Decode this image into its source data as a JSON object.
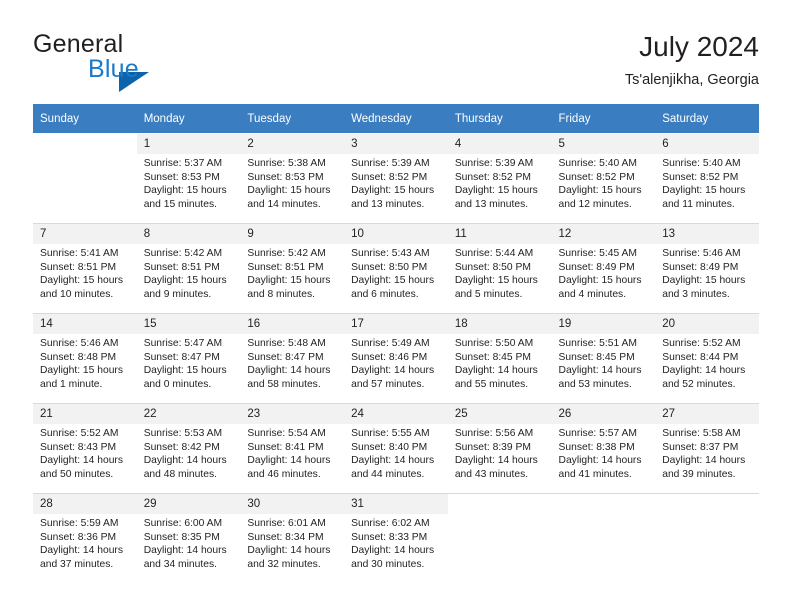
{
  "brand": {
    "name_top": "General",
    "name_bottom": "Blue",
    "mark": "triangle-logo",
    "blue": "#1a79c8"
  },
  "header": {
    "title": "July 2024",
    "subtitle": "Ts'alenjikha, Georgia"
  },
  "theme": {
    "header_row_bg": "#3b7dc1",
    "header_row_text": "#ffffff",
    "shaded_cell_bg": "#f2f2f2",
    "text": "#231f20"
  },
  "weekday_headers": [
    "Sunday",
    "Monday",
    "Tuesday",
    "Wednesday",
    "Thursday",
    "Friday",
    "Saturday"
  ],
  "weeks": [
    [
      {
        "day": "",
        "sunrise": "",
        "sunset": "",
        "daylight": "",
        "empty": true
      },
      {
        "day": "1",
        "sunrise": "Sunrise: 5:37 AM",
        "sunset": "Sunset: 8:53 PM",
        "daylight_1": "Daylight: 15 hours",
        "daylight_2": "and 15 minutes."
      },
      {
        "day": "2",
        "sunrise": "Sunrise: 5:38 AM",
        "sunset": "Sunset: 8:53 PM",
        "daylight_1": "Daylight: 15 hours",
        "daylight_2": "and 14 minutes."
      },
      {
        "day": "3",
        "sunrise": "Sunrise: 5:39 AM",
        "sunset": "Sunset: 8:52 PM",
        "daylight_1": "Daylight: 15 hours",
        "daylight_2": "and 13 minutes."
      },
      {
        "day": "4",
        "sunrise": "Sunrise: 5:39 AM",
        "sunset": "Sunset: 8:52 PM",
        "daylight_1": "Daylight: 15 hours",
        "daylight_2": "and 13 minutes."
      },
      {
        "day": "5",
        "sunrise": "Sunrise: 5:40 AM",
        "sunset": "Sunset: 8:52 PM",
        "daylight_1": "Daylight: 15 hours",
        "daylight_2": "and 12 minutes."
      },
      {
        "day": "6",
        "sunrise": "Sunrise: 5:40 AM",
        "sunset": "Sunset: 8:52 PM",
        "daylight_1": "Daylight: 15 hours",
        "daylight_2": "and 11 minutes."
      }
    ],
    [
      {
        "day": "7",
        "sunrise": "Sunrise: 5:41 AM",
        "sunset": "Sunset: 8:51 PM",
        "daylight_1": "Daylight: 15 hours",
        "daylight_2": "and 10 minutes."
      },
      {
        "day": "8",
        "sunrise": "Sunrise: 5:42 AM",
        "sunset": "Sunset: 8:51 PM",
        "daylight_1": "Daylight: 15 hours",
        "daylight_2": "and 9 minutes."
      },
      {
        "day": "9",
        "sunrise": "Sunrise: 5:42 AM",
        "sunset": "Sunset: 8:51 PM",
        "daylight_1": "Daylight: 15 hours",
        "daylight_2": "and 8 minutes."
      },
      {
        "day": "10",
        "sunrise": "Sunrise: 5:43 AM",
        "sunset": "Sunset: 8:50 PM",
        "daylight_1": "Daylight: 15 hours",
        "daylight_2": "and 6 minutes."
      },
      {
        "day": "11",
        "sunrise": "Sunrise: 5:44 AM",
        "sunset": "Sunset: 8:50 PM",
        "daylight_1": "Daylight: 15 hours",
        "daylight_2": "and 5 minutes."
      },
      {
        "day": "12",
        "sunrise": "Sunrise: 5:45 AM",
        "sunset": "Sunset: 8:49 PM",
        "daylight_1": "Daylight: 15 hours",
        "daylight_2": "and 4 minutes."
      },
      {
        "day": "13",
        "sunrise": "Sunrise: 5:46 AM",
        "sunset": "Sunset: 8:49 PM",
        "daylight_1": "Daylight: 15 hours",
        "daylight_2": "and 3 minutes."
      }
    ],
    [
      {
        "day": "14",
        "sunrise": "Sunrise: 5:46 AM",
        "sunset": "Sunset: 8:48 PM",
        "daylight_1": "Daylight: 15 hours",
        "daylight_2": "and 1 minute."
      },
      {
        "day": "15",
        "sunrise": "Sunrise: 5:47 AM",
        "sunset": "Sunset: 8:47 PM",
        "daylight_1": "Daylight: 15 hours",
        "daylight_2": "and 0 minutes."
      },
      {
        "day": "16",
        "sunrise": "Sunrise: 5:48 AM",
        "sunset": "Sunset: 8:47 PM",
        "daylight_1": "Daylight: 14 hours",
        "daylight_2": "and 58 minutes."
      },
      {
        "day": "17",
        "sunrise": "Sunrise: 5:49 AM",
        "sunset": "Sunset: 8:46 PM",
        "daylight_1": "Daylight: 14 hours",
        "daylight_2": "and 57 minutes."
      },
      {
        "day": "18",
        "sunrise": "Sunrise: 5:50 AM",
        "sunset": "Sunset: 8:45 PM",
        "daylight_1": "Daylight: 14 hours",
        "daylight_2": "and 55 minutes."
      },
      {
        "day": "19",
        "sunrise": "Sunrise: 5:51 AM",
        "sunset": "Sunset: 8:45 PM",
        "daylight_1": "Daylight: 14 hours",
        "daylight_2": "and 53 minutes."
      },
      {
        "day": "20",
        "sunrise": "Sunrise: 5:52 AM",
        "sunset": "Sunset: 8:44 PM",
        "daylight_1": "Daylight: 14 hours",
        "daylight_2": "and 52 minutes."
      }
    ],
    [
      {
        "day": "21",
        "sunrise": "Sunrise: 5:52 AM",
        "sunset": "Sunset: 8:43 PM",
        "daylight_1": "Daylight: 14 hours",
        "daylight_2": "and 50 minutes."
      },
      {
        "day": "22",
        "sunrise": "Sunrise: 5:53 AM",
        "sunset": "Sunset: 8:42 PM",
        "daylight_1": "Daylight: 14 hours",
        "daylight_2": "and 48 minutes."
      },
      {
        "day": "23",
        "sunrise": "Sunrise: 5:54 AM",
        "sunset": "Sunset: 8:41 PM",
        "daylight_1": "Daylight: 14 hours",
        "daylight_2": "and 46 minutes."
      },
      {
        "day": "24",
        "sunrise": "Sunrise: 5:55 AM",
        "sunset": "Sunset: 8:40 PM",
        "daylight_1": "Daylight: 14 hours",
        "daylight_2": "and 44 minutes."
      },
      {
        "day": "25",
        "sunrise": "Sunrise: 5:56 AM",
        "sunset": "Sunset: 8:39 PM",
        "daylight_1": "Daylight: 14 hours",
        "daylight_2": "and 43 minutes."
      },
      {
        "day": "26",
        "sunrise": "Sunrise: 5:57 AM",
        "sunset": "Sunset: 8:38 PM",
        "daylight_1": "Daylight: 14 hours",
        "daylight_2": "and 41 minutes."
      },
      {
        "day": "27",
        "sunrise": "Sunrise: 5:58 AM",
        "sunset": "Sunset: 8:37 PM",
        "daylight_1": "Daylight: 14 hours",
        "daylight_2": "and 39 minutes."
      }
    ],
    [
      {
        "day": "28",
        "sunrise": "Sunrise: 5:59 AM",
        "sunset": "Sunset: 8:36 PM",
        "daylight_1": "Daylight: 14 hours",
        "daylight_2": "and 37 minutes."
      },
      {
        "day": "29",
        "sunrise": "Sunrise: 6:00 AM",
        "sunset": "Sunset: 8:35 PM",
        "daylight_1": "Daylight: 14 hours",
        "daylight_2": "and 34 minutes."
      },
      {
        "day": "30",
        "sunrise": "Sunrise: 6:01 AM",
        "sunset": "Sunset: 8:34 PM",
        "daylight_1": "Daylight: 14 hours",
        "daylight_2": "and 32 minutes."
      },
      {
        "day": "31",
        "sunrise": "Sunrise: 6:02 AM",
        "sunset": "Sunset: 8:33 PM",
        "daylight_1": "Daylight: 14 hours",
        "daylight_2": "and 30 minutes."
      },
      {
        "day": "",
        "sunrise": "",
        "sunset": "",
        "daylight": "",
        "empty": true
      },
      {
        "day": "",
        "sunrise": "",
        "sunset": "",
        "daylight": "",
        "empty": true
      },
      {
        "day": "",
        "sunrise": "",
        "sunset": "",
        "daylight": "",
        "empty": true
      }
    ]
  ]
}
